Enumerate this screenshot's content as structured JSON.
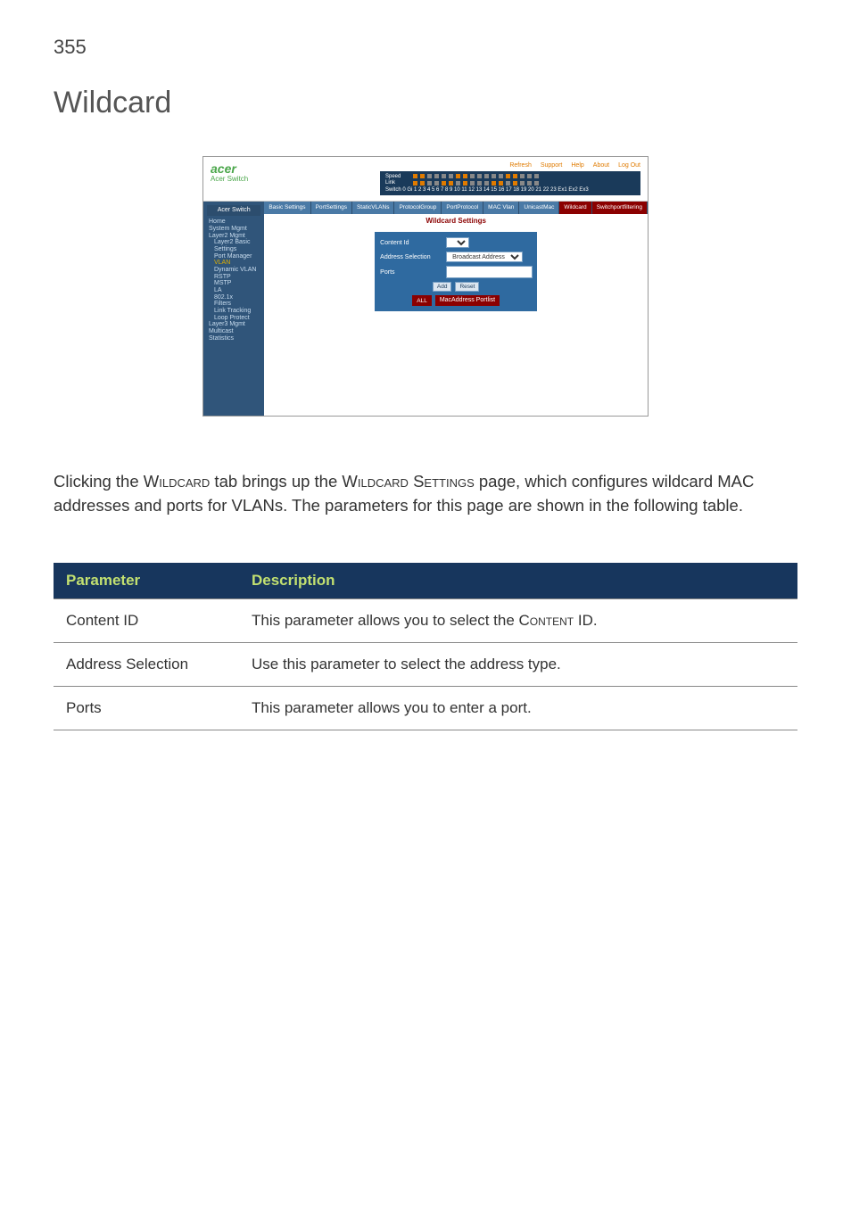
{
  "page_number": "355",
  "title": "Wildcard",
  "screenshot": {
    "brand": "acer",
    "brand_sub": "Acer Switch",
    "top_links": [
      "Refresh",
      "Support",
      "Help",
      "About",
      "Log Out"
    ],
    "port_labels": {
      "speed": "Speed",
      "link": "Link",
      "switch_row": "Switch 0 Gi 1 2 3 4 5 6 7 8 9 10 11 12 13 14 15 16 17 18 19 20 21 22 23 Ex1 Ex2 Ex3"
    },
    "sidebar_title": "Acer Switch",
    "sidebar": {
      "home": "Home",
      "system": "System Mgmt",
      "layer2": "Layer2 Mgmt",
      "l2_basic": "Layer2 Basic Settings",
      "port_mgr": "Port Manager",
      "vlan": "VLAN",
      "dyn_vlan": "Dynamic VLAN",
      "rstp": "RSTP",
      "mstp": "MSTP",
      "la": "LA",
      "8021x": "802.1x",
      "filters": "Filters",
      "link_track": "Link Tracking",
      "loop_protect": "Loop Protect",
      "layer3": "Layer3 Mgmt",
      "multicast": "Multicast",
      "statistics": "Statistics"
    },
    "tabs": [
      "Basic Settings",
      "PortSettings",
      "StaticVLANs",
      "ProtocolGroup",
      "PortProtocol",
      "MAC Vlan",
      "UnicastMac",
      "Wildcard",
      "Switchportfiltering"
    ],
    "panel_heading": "Wildcard Settings",
    "form": {
      "content_id_label": "Content Id",
      "content_id_value": "",
      "addr_sel_label": "Address Selection",
      "addr_sel_value": "Broadcast Address",
      "ports_label": "Ports",
      "ports_value": "",
      "btn_add": "Add",
      "btn_reset": "Reset",
      "btn_all": "ALL"
    },
    "result_header": "MacAddress Portlist"
  },
  "paragraph_parts": {
    "p1a": "Clicking the ",
    "p1b": "Wildcard",
    "p1c": " tab brings up the ",
    "p1d": "Wildcard Settings",
    "p1e": " page, which configures wildcard MAC addresses and ports for VLANs. The parameters for this page are shown in the following table."
  },
  "table": {
    "head_param": "Parameter",
    "head_desc": "Description",
    "rows": [
      {
        "param": "Content ID",
        "desc_a": "This parameter allows you to select the ",
        "desc_sc": "Content ID",
        "desc_b": "."
      },
      {
        "param": "Address Selection",
        "desc_a": "Use this parameter to select the address type.",
        "desc_sc": "",
        "desc_b": ""
      },
      {
        "param": "Ports",
        "desc_a": "This parameter allows you to enter a port.",
        "desc_sc": "",
        "desc_b": ""
      }
    ]
  }
}
